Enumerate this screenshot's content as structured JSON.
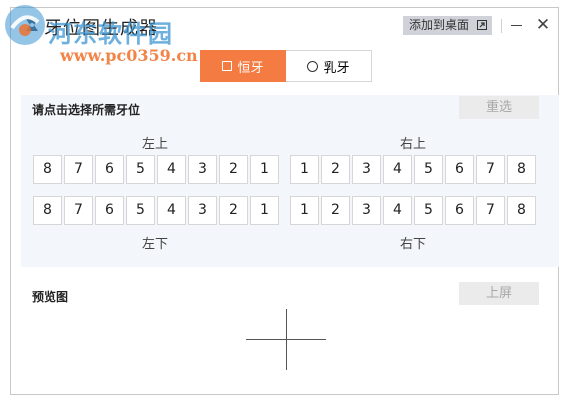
{
  "window": {
    "title": "牙位图生成器",
    "add_to_desktop": "添加到桌面",
    "close_glyph": "✕"
  },
  "tabs": [
    {
      "label": "恒牙",
      "active": true
    },
    {
      "label": "乳牙",
      "active": false
    }
  ],
  "select_section": {
    "title": "请点击选择所需牙位",
    "reset_button": "重选",
    "upper_left_label": "左上",
    "upper_right_label": "右上",
    "lower_left_label": "左下",
    "lower_right_label": "右下",
    "upper_left": [
      "8",
      "7",
      "6",
      "5",
      "4",
      "3",
      "2",
      "1"
    ],
    "upper_right": [
      "1",
      "2",
      "3",
      "4",
      "5",
      "6",
      "7",
      "8"
    ],
    "lower_left": [
      "8",
      "7",
      "6",
      "5",
      "4",
      "3",
      "2",
      "1"
    ],
    "lower_right": [
      "1",
      "2",
      "3",
      "4",
      "5",
      "6",
      "7",
      "8"
    ]
  },
  "preview_section": {
    "title": "预览图",
    "upload_button": "上屏"
  },
  "watermark": {
    "site_name": "河东软件园",
    "url": "www.pc0359.cn"
  },
  "colors": {
    "accent": "#f47b41",
    "panel_bg": "#f3f7fb"
  }
}
